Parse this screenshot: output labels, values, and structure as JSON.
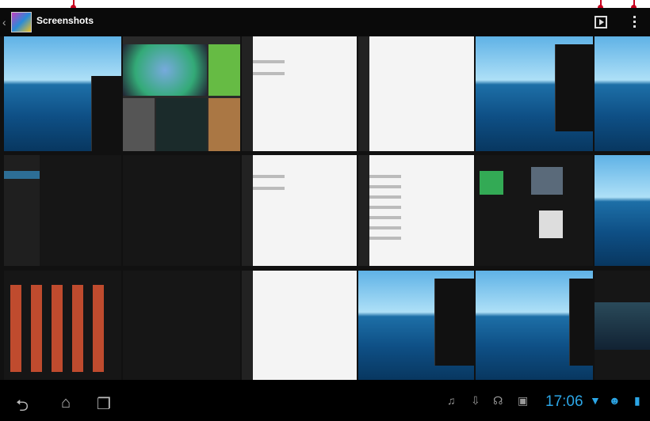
{
  "app": {
    "title": "Screenshots",
    "icon": "gallery-icon"
  },
  "actions": {
    "slideshow": "slideshow-icon",
    "menu": "overflow-menu-icon"
  },
  "grid": {
    "columns": 6,
    "rows": 3,
    "row1": [
      "Home screen (ocean)",
      "Gallery albums",
      "Settings list (white)",
      "Settings blank (white)",
      "Home screen with notification panel",
      "Home screen (ocean)"
    ],
    "row2": [
      "Dark settings",
      "Dark dialog",
      "Settings list (white)",
      "Settings list long (white)",
      "Widgets screen",
      "Home screen (ocean)"
    ],
    "row3": [
      "App drawer",
      "Dark settings",
      "Settings list (white)",
      "Home screen with notification panel",
      "Home screen (ocean)",
      "Dark home screen"
    ]
  },
  "navbar": {
    "back": "back-icon",
    "home": "home-icon",
    "recent": "recent-apps-icon",
    "clock": "17:06",
    "accent": "#2ca6e6"
  }
}
